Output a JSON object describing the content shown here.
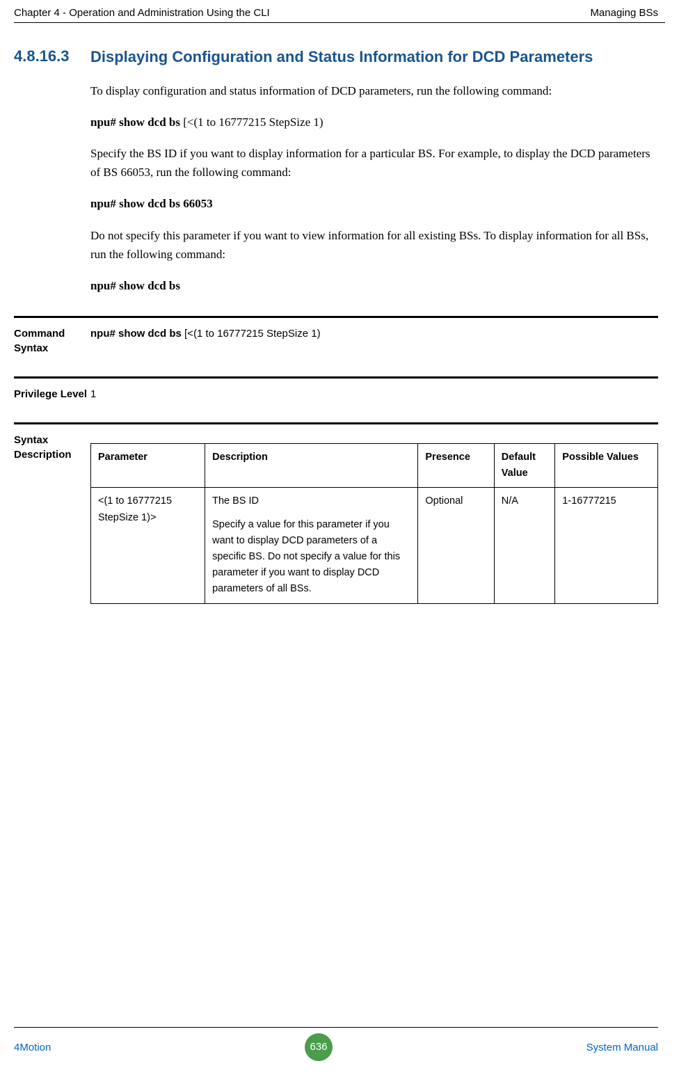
{
  "header": {
    "left": "Chapter 4 - Operation and Administration Using the CLI",
    "right": "Managing BSs"
  },
  "section": {
    "number": "4.8.16.3",
    "title": "Displaying Configuration and Status Information for DCD Parameters"
  },
  "paragraphs": {
    "p1": "To display configuration and status information of DCD parameters, run the following command:",
    "p2_bold": "npu# show dcd bs ",
    "p2_rest": "[<(1 to 16777215 StepSize 1)",
    "p3": "Specify the BS ID if you want to display information for a particular BS. For example, to display the DCD parameters of BS 66053, run the following command:",
    "p4": "npu# show dcd bs 66053",
    "p5": "Do not specify this parameter if you want to view information for all existing BSs. To display information for all BSs, run the following command:",
    "p6": "npu# show dcd bs"
  },
  "command_syntax": {
    "label": "Command Syntax",
    "value_bold": "npu# show dcd bs ",
    "value_rest": "[<(1 to 16777215 StepSize 1)"
  },
  "privilege_level": {
    "label": "Privilege Level",
    "value": "1"
  },
  "syntax_description": {
    "label": "Syntax Description",
    "headers": {
      "parameter": "Parameter",
      "description": "Description",
      "presence": "Presence",
      "default_value": "Default Value",
      "possible_values": "Possible Values"
    },
    "row": {
      "parameter": "<(1 to 16777215 StepSize 1)>",
      "description_line1": "The BS ID",
      "description_rest": "Specify a value for this parameter if you want to display DCD parameters of a specific BS. Do not specify a value for this parameter if you want to display DCD parameters of all BSs.",
      "presence": "Optional",
      "default_value": "N/A",
      "possible_values": "1-16777215"
    }
  },
  "footer": {
    "left": "4Motion",
    "page": "636",
    "right": "System Manual"
  }
}
